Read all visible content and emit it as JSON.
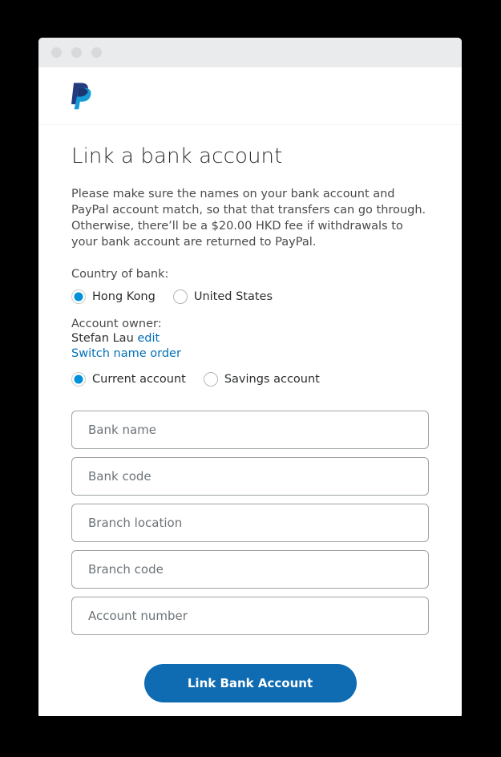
{
  "window": {
    "traffic_lights": [
      "close-dot",
      "minimize-dot",
      "maximize-dot"
    ],
    "logo_name": "paypal-logo"
  },
  "page": {
    "title": "Link a bank account",
    "intro": "Please make sure the names on your bank account and PayPal account match, so that that transfers can go through. Otherwise, there’ll be a $20.00 HKD fee if withdrawals to your bank account are returned to PayPal."
  },
  "country": {
    "label": "Country of bank:",
    "options": [
      {
        "label": "Hong Kong",
        "selected": true
      },
      {
        "label": "United States",
        "selected": false
      }
    ]
  },
  "owner": {
    "label": "Account owner:",
    "name": "Stefan Lau",
    "edit_link": "edit",
    "switch_link": "Switch name order"
  },
  "account_type": {
    "options": [
      {
        "label": "Current account",
        "selected": true
      },
      {
        "label": "Savings account",
        "selected": false
      }
    ]
  },
  "form": {
    "fields": [
      {
        "name": "bank-name",
        "placeholder": "Bank name",
        "value": ""
      },
      {
        "name": "bank-code",
        "placeholder": "Bank code",
        "value": ""
      },
      {
        "name": "branch-location",
        "placeholder": "Branch location",
        "value": ""
      },
      {
        "name": "branch-code",
        "placeholder": "Branch code",
        "value": ""
      },
      {
        "name": "account-number",
        "placeholder": "Account number",
        "value": ""
      }
    ],
    "submit_label": "Link Bank Account"
  },
  "colors": {
    "brand_blue": "#0f6cb2",
    "link_blue": "#0070ba",
    "radio_blue": "#0091da",
    "logo_dark": "#253b80",
    "logo_light": "#179bd7",
    "titlebar": "#eaebec",
    "dot": "#d8d9da",
    "text_dark": "#2c2e2f",
    "text_body": "#4a4a4a",
    "placeholder": "#6c7378",
    "input_border": "#9da3a6",
    "page_background": "#000000"
  }
}
